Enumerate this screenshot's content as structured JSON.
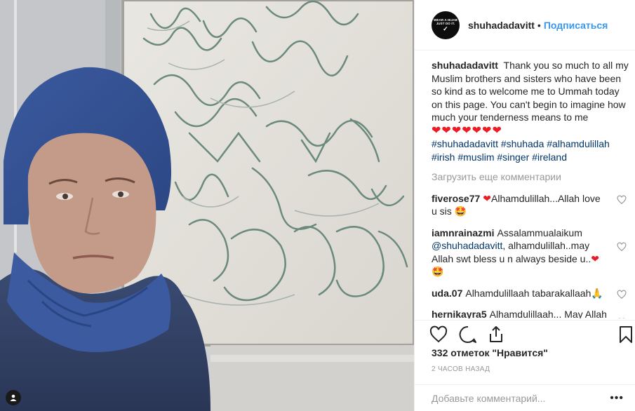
{
  "photo": {
    "badge_icon": "person-tag-icon"
  },
  "avatar": {
    "line1": "WEAR A HIJAB",
    "line2": "JUST DO IT.",
    "swoosh": "✓"
  },
  "header": {
    "username": "shuhadadavitt",
    "separator": "•",
    "follow_label": "Подписаться"
  },
  "caption": {
    "username": "shuhadadavitt",
    "text": "Thank you so much to all my Muslim brothers and sisters who have been so kind as to welcome me to Ummah today on this page. You can't begin to imagine how much your tenderness means to me",
    "hearts": "❤❤❤❤❤❤❤",
    "hashtags": [
      "#shuhadadavitt",
      "#shuhada",
      "#alhamdulillah",
      "#irish",
      "#muslim",
      "#singer",
      "#ireland"
    ]
  },
  "load_more": "Загрузить еще комментарии",
  "comments": [
    {
      "username": "fiverose77",
      "prefix": "❤",
      "text": "Alhamdulillah...Allah love u sis",
      "suffix": "🤩"
    },
    {
      "username": "iamnrainazmi",
      "text_before": "Assalammualaikum",
      "mention": "@shuhadadavitt",
      "text": ", alhamdulillah..may Allah swt bless u n always beside u..",
      "suffix_heart": "❤",
      "suffix": "🤩"
    },
    {
      "username": "uda.07",
      "text": "Alhamdulillaah tabarakallaah",
      "suffix": "🙏"
    },
    {
      "username": "hernikayra5",
      "text": "Alhamdulillaah... May Allah bless u and guide u to the right path",
      "suffix": ""
    }
  ],
  "likes": "332 отметок \"Нравится\"",
  "time": "2 часов назад",
  "add_comment": {
    "placeholder": "Добавьте комментарий...",
    "more": "•••"
  },
  "icons": {
    "like": "heart-outline-icon",
    "comment": "comment-bubble-icon",
    "share": "share-icon",
    "save": "bookmark-icon"
  }
}
